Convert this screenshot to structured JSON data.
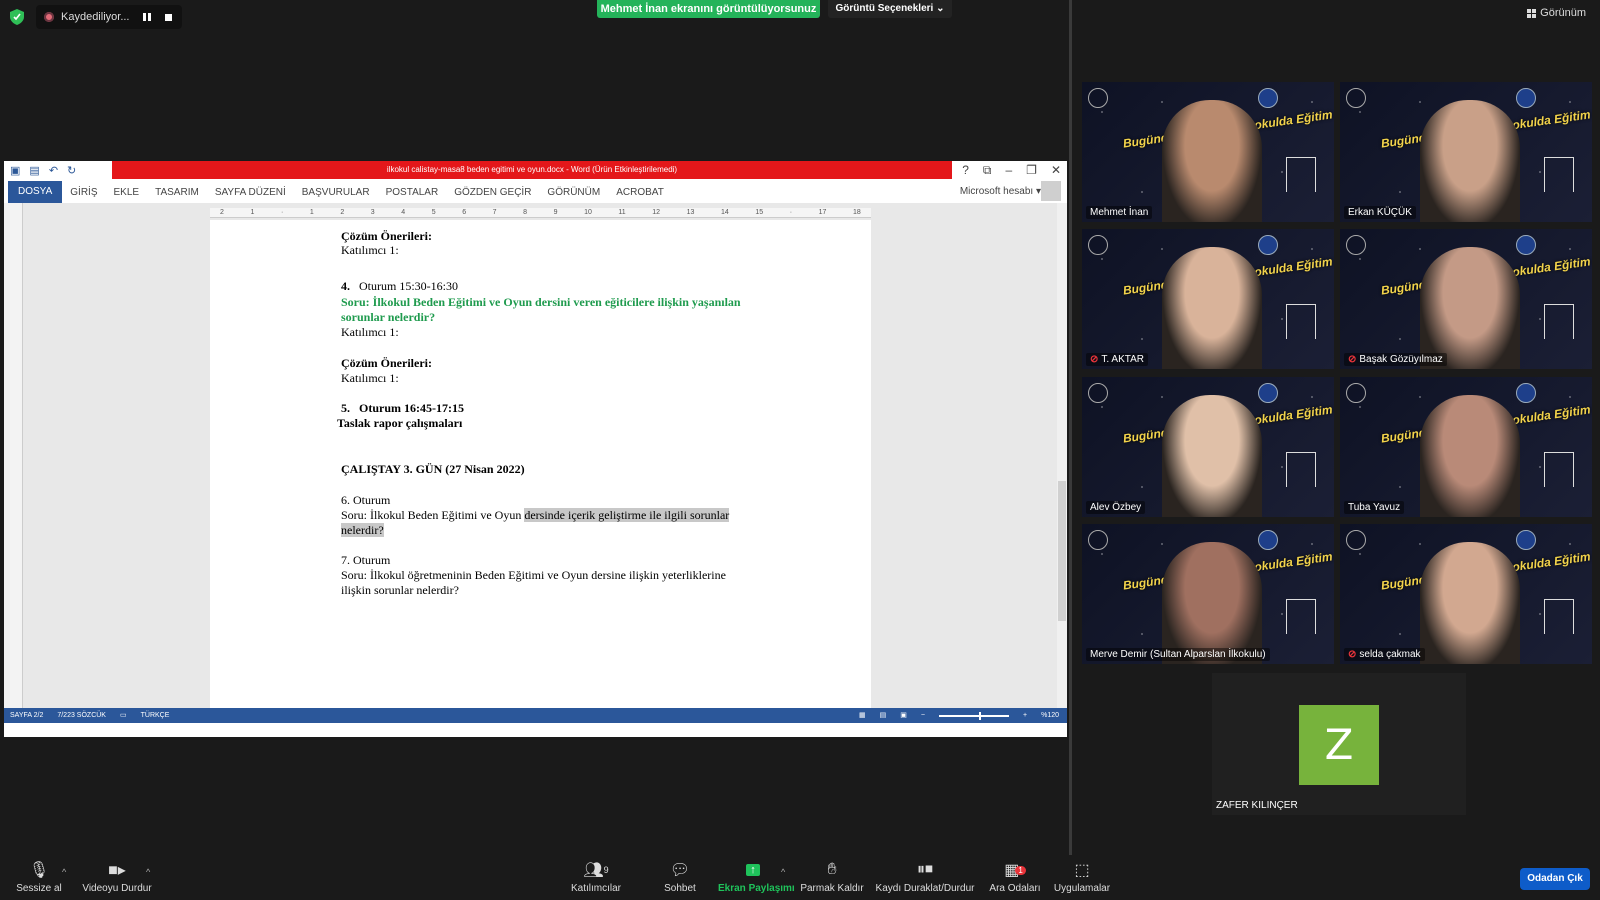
{
  "top": {
    "recording_label": "Kaydediliyor...",
    "share_banner": "Mehmet İnan ekranını görüntülüyorsunuz",
    "view_options": "Görüntü Seçenekleri",
    "view_label": "Görünüm"
  },
  "word": {
    "title": "ilkokul calistay-masa8 beden egitimi ve oyun.docx - Word (Ürün Etkinleştirilemedi)",
    "tabs": [
      "DOSYA",
      "GİRİŞ",
      "EKLE",
      "TASARIM",
      "SAYFA DÜZENİ",
      "BAŞVURULAR",
      "POSTALAR",
      "GÖZDEN GEÇİR",
      "GÖRÜNÜM",
      "ACROBAT"
    ],
    "account": "Microsoft hesabı",
    "ruler_marks": [
      "2",
      "1",
      "",
      "1",
      "2",
      "3",
      "4",
      "5",
      "6",
      "7",
      "8",
      "9",
      "10",
      "11",
      "12",
      "13",
      "14",
      "15",
      "",
      "17",
      "18"
    ],
    "status": {
      "page": "SAYFA 2/2",
      "words": "7/223 SÖZCÜK",
      "lang": "TÜRKÇE",
      "zoom": "%120"
    },
    "doc": {
      "l1": "Çözüm Önerileri:",
      "l2": "Katılımcı 1:",
      "l3_num": "4.",
      "l3": "Oturum 15:30-16:30",
      "l4": "Soru: İlkokul Beden Eğitimi ve Oyun dersini veren eğiticilere ilişkin yaşanılan",
      "l5": "sorunlar nelerdir?",
      "l6": "Katılımcı 1:",
      "l7": "Çözüm Önerileri:",
      "l8": "Katılımcı 1:",
      "l9_num": "5.",
      "l9": "Oturum 16:45-17:15",
      "l10": "Taslak rapor çalışmaları",
      "l11": "ÇALIŞTAY 3. GÜN (27 Nisan 2022)",
      "l12": "6.   Oturum",
      "l13a": "Soru: İlkokul Beden Eğitimi ve Oyun ",
      "l13b": "dersinde içerik geliştirme ile ilgili sorunlar",
      "l14": "nelerdir? ",
      "l15": "7.   Oturum",
      "l16": "Soru: İlkokul öğretmeninin Beden Eğitimi ve Oyun dersine ilişkin yeterliklerine",
      "l17": "ilişkin sorunlar nelerdir?"
    }
  },
  "participants": {
    "tile_banner": "Bugünden Geleceğe İlkokulda Eğitim",
    "names": [
      "Mehmet İnan",
      "Erkan KÜÇÜK",
      "T. AKTAR",
      "Başak Gözüyılmaz",
      "Alev Özbey",
      "Tuba Yavuz",
      "Merve Demir (Sultan Alparslan İlkokulu)",
      "selda çakmak"
    ],
    "audio_only": {
      "initial": "Z",
      "name": "ZAFER KILINÇER"
    }
  },
  "toolbar": {
    "mute": "Sessize al",
    "video": "Videoyu Durdur",
    "participants": "Katılımcılar",
    "participants_count": "9",
    "chat": "Sohbet",
    "share": "Ekran Paylaşımı",
    "raise": "Parmak Kaldır",
    "record": "Kaydı Duraklat/Durdur",
    "breakout": "Ara Odaları",
    "breakout_badge": "1",
    "apps": "Uygulamalar",
    "leave": "Odadan Çık"
  },
  "colors": {
    "share_green": "#24b35a",
    "word_red": "#e4171a",
    "word_blue": "#2b579a",
    "speaker_outline": "#b8e04a",
    "leave_blue": "#0e5cc9",
    "avatar_green": "#77b33c"
  }
}
